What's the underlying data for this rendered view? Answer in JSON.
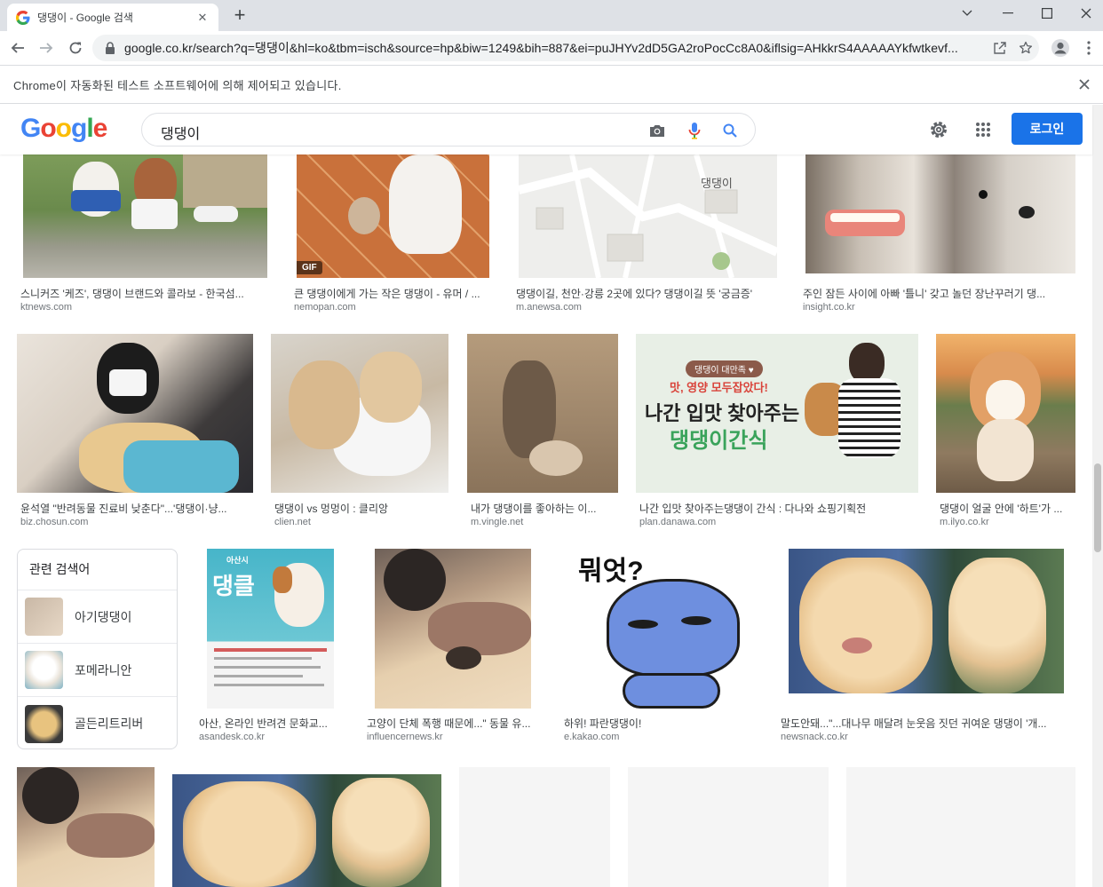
{
  "browser": {
    "tab_title": "댕댕이 - Google 검색",
    "new_tab_symbol": "+",
    "url": "google.co.kr/search?q=댕댕이&hl=ko&tbm=isch&source=hp&biw=1249&bih=887&ei=puJHYv2dD5GA2roPocCc8A0&iflsig=AHkkrS4AAAAAYkfwtkevf...",
    "automation_message": "Chrome이 자동화된 테스트 소프트웨어에 의해 제어되고 있습니다."
  },
  "google": {
    "logo_text": "Google",
    "query": "댕댕이",
    "login_label": "로그인"
  },
  "colors": {
    "accent": "#1a73e8",
    "logo_blue": "#4285f4",
    "logo_red": "#ea4335",
    "logo_yellow": "#fbbc05",
    "logo_green": "#34a853"
  },
  "results_row1": [
    {
      "caption": "스니커즈 '케즈', 댕댕이 브랜드와 콜라보 - 한국섬...",
      "source": "ktnews.com"
    },
    {
      "caption": "큰 댕댕이에게 가는 작은 댕댕이 - 유머 / ...",
      "source": "nemopan.com",
      "badge": "GIF"
    },
    {
      "caption": "댕댕이길, 천안·강릉 2곳에 있다? 댕댕이길 뜻 '궁금증'",
      "source": "m.anewsa.com",
      "map_label": "댕댕이"
    },
    {
      "caption": "주인 잠든 사이에 아빠 '틀니' 갖고 놀던 장난꾸러기 댕...",
      "source": "insight.co.kr"
    }
  ],
  "results_row2": [
    {
      "caption": "윤석열 \"반려동물 진료비 낮춘다\"...'댕댕이·냥...",
      "source": "biz.chosun.com"
    },
    {
      "caption": "댕댕이 vs 멍멍이 : 클리앙",
      "source": "clien.net"
    },
    {
      "caption": "내가 댕댕이를 좋아하는 이...",
      "source": "m.vingle.net"
    },
    {
      "caption": "나간 입맛 찾아주는댕댕이 간식 : 다나와 쇼핑기획전",
      "source": "plan.danawa.com",
      "ad_pill": "댕댕이 대만족 ♥",
      "ad_hand": "맛, 영양 모두잡았다!",
      "ad_line1": "나간 입맛 찾아주는",
      "ad_line2": "댕댕이간식"
    },
    {
      "caption": "댕댕이 얼굴 안에 '하트'가 ...",
      "source": "m.ilyo.co.kr"
    }
  ],
  "related_searches": {
    "title": "관련 검색어",
    "items": [
      {
        "label": "아기댕댕이"
      },
      {
        "label": "포메라니안"
      },
      {
        "label": "골든리트리버"
      }
    ]
  },
  "results_row3": [
    {
      "caption": "아산, 온라인 반려견 문화교...",
      "source": "asandesk.co.kr",
      "poster_city": "아산시",
      "poster_title": "댕클"
    },
    {
      "caption": "고양이 단체 폭행 때문에...\" 동물 유...",
      "source": "influencernews.kr"
    },
    {
      "caption": "하위! 파란댕댕이!",
      "source": "e.kakao.com",
      "comic_text": "뭐엇?"
    },
    {
      "caption": "말도안돼...\"...대나무 매달려 눈웃음 짓던 귀여운 댕댕이 '개...",
      "source": "newsnack.co.kr"
    }
  ]
}
